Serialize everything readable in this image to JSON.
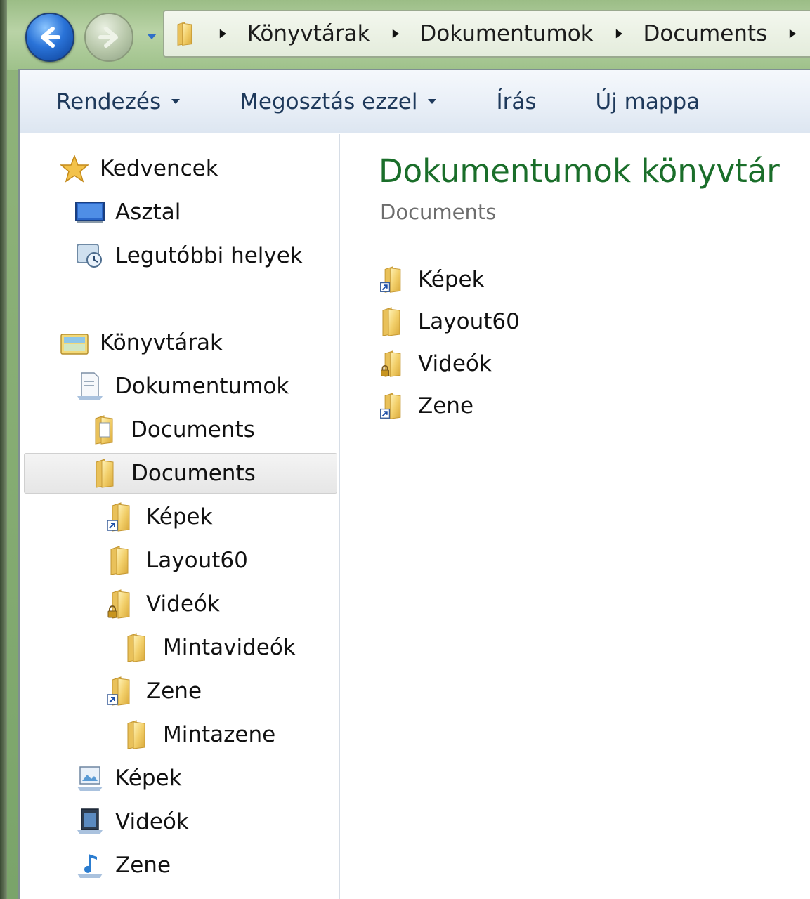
{
  "address_bar": {
    "crumbs": [
      "Könyvtárak",
      "Dokumentumok",
      "Documents"
    ]
  },
  "toolbar": {
    "organize_label": "Rendezés",
    "share_label": "Megosztás ezzel",
    "burn_label": "Írás",
    "new_folder_label": "Új mappa"
  },
  "nav": {
    "favorites": {
      "label": "Kedvencek"
    },
    "desktop": {
      "label": "Asztal"
    },
    "recent": {
      "label": "Legutóbbi helyek"
    },
    "libraries": {
      "label": "Könyvtárak"
    },
    "documents_lib": {
      "label": "Dokumentumok"
    },
    "documents_public": {
      "label": "Documents"
    },
    "documents_selected": {
      "label": "Documents"
    },
    "pictures_link": {
      "label": "Képek"
    },
    "layout60": {
      "label": "Layout60"
    },
    "videos_locked": {
      "label": "Videók"
    },
    "sample_videos": {
      "label": "Mintavideók"
    },
    "music_link": {
      "label": "Zene"
    },
    "sample_music": {
      "label": "Mintazene"
    },
    "pictures_lib": {
      "label": "Képek"
    },
    "videos_lib": {
      "label": "Videók"
    },
    "music_lib": {
      "label": "Zene"
    }
  },
  "content": {
    "title": "Dokumentumok könyvtár",
    "subtitle": "Documents",
    "items": [
      {
        "label": "Képek",
        "icon": "folder-shortcut-icon"
      },
      {
        "label": "Layout60",
        "icon": "folder-icon"
      },
      {
        "label": "Videók",
        "icon": "folder-locked-icon"
      },
      {
        "label": "Zene",
        "icon": "folder-shortcut-icon"
      }
    ]
  },
  "colors": {
    "library_title": "#1a6e2a",
    "toolbar_text": "#1e395b",
    "folder_yellow": "#f2cf6a"
  }
}
